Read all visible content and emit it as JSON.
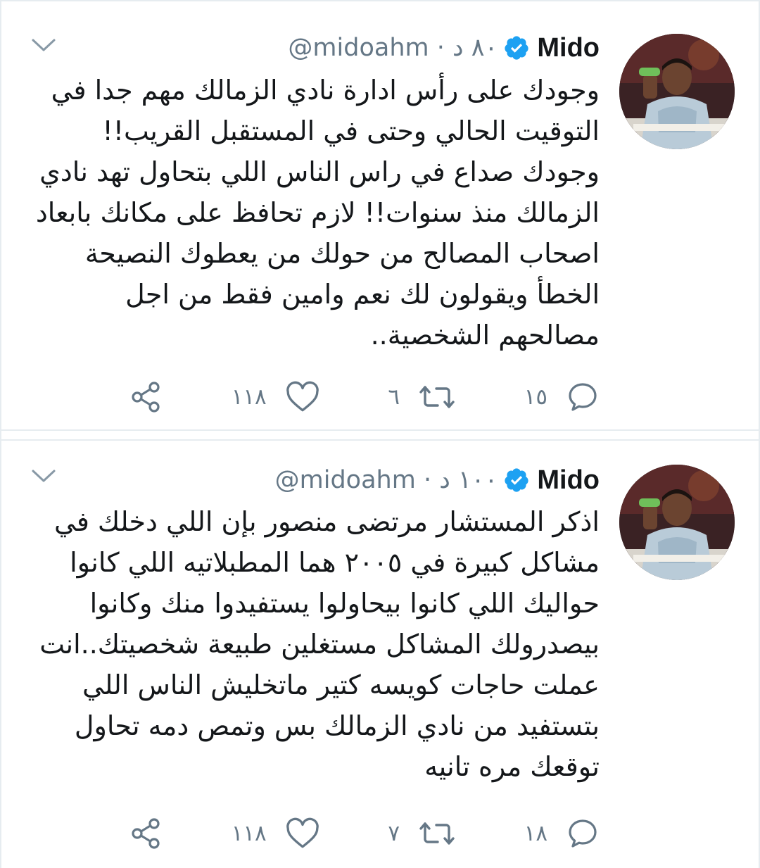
{
  "colors": {
    "verified_badge": "#1da1f2",
    "secondary_text": "#657786",
    "primary_text": "#14171a",
    "divider": "#e6ecf0"
  },
  "tweets": [
    {
      "name": "Mido",
      "handle": "@midoahm",
      "separator": "·",
      "time": "٨٠ د",
      "verified_icon": "verified-badge-icon",
      "text": "وجودك على رأس ادارة نادي الزمالك مهم جدا في التوقيت الحالي وحتى في المستقبل القريب!!\nوجودك صداع في راس الناس اللي بتحاول تهد نادي الزمالك منذ سنوات!! لازم تحافظ على مكانك بابعاد اصحاب المصالح من حولك من يعطوك النصيحة الخطأ ويقولون لك نعم وامين فقط من اجل مصالحهم الشخصية..",
      "replies": "١٥",
      "retweets": "٦",
      "likes": "١١٨"
    },
    {
      "name": "Mido",
      "handle": "@midoahm",
      "separator": "·",
      "time": "١٠٠ د",
      "verified_icon": "verified-badge-icon",
      "text": "اذكر المستشار مرتضى منصور بإن اللي دخلك في مشاكل كبيرة في ٢٠٠٥ هما المطبلاتيه اللي كانوا حواليك اللي كانوا بيحاولوا يستفيدوا منك وكانوا بيصدرولك المشاكل مستغلين طبيعة شخصيتك..انت عملت حاجات كويسه كتير ماتخليش الناس اللي بتستفيد من نادي الزمالك بس وتمص دمه تحاول توقعك مره تانيه",
      "replies": "١٨",
      "retweets": "٧",
      "likes": "١١٨"
    }
  ]
}
